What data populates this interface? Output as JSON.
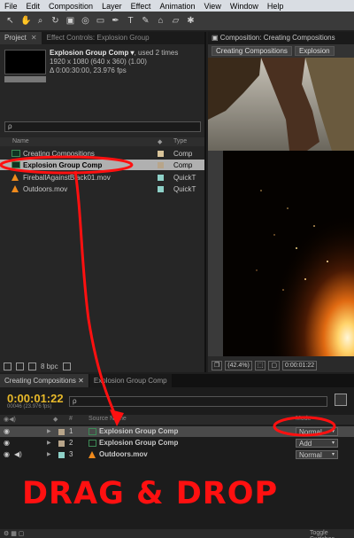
{
  "menu": [
    "File",
    "Edit",
    "Composition",
    "Layer",
    "Effect",
    "Animation",
    "View",
    "Window",
    "Help"
  ],
  "toolbar_icons": [
    "selection-icon",
    "hand-icon",
    "zoom-icon",
    "rotate-icon",
    "camera-icon",
    "pan-behind-icon",
    "mask-icon",
    "pen-icon",
    "type-icon",
    "brush-icon",
    "clone-stamp-icon",
    "eraser-icon",
    "puppet-icon"
  ],
  "project": {
    "tab": "Project",
    "effect_tab": "Effect Controls: Explosion Group",
    "info": {
      "name": "Explosion Group Comp ▾",
      "used": ", used 2 times",
      "size": "1920 x 1080  (640 x 360) (1.00)",
      "duration": "Δ 0:00:30:00, 23.976 fps"
    },
    "search_placeholder": "ρ",
    "col_name": "Name",
    "col_type": "Type",
    "items": [
      {
        "name": "Creating Compositions",
        "type": "Comp",
        "label_color": "#d9c49a",
        "icon": "composition-icon"
      },
      {
        "name": "Explosion Group Comp",
        "type": "Comp",
        "label_color": "#b8a58a",
        "icon": "composition-icon"
      },
      {
        "name": "FireballAgainstBlack01.mov",
        "type": "QuickT",
        "label_color": "#8ed1c8",
        "icon": "footage-icon"
      },
      {
        "name": "Outdoors.mov",
        "type": "QuickT",
        "label_color": "#8ed1c8",
        "icon": "vlc-cone-icon"
      }
    ],
    "bpc": "8 bpc"
  },
  "comp": {
    "tab": "Composition: Creating Compositions",
    "breadcrumbs": [
      "Creating Compositions",
      "Explosion"
    ],
    "zoom": "(42.4%)",
    "timecode": "0:00:01:22"
  },
  "timeline": {
    "tabs": [
      "Creating Compositions",
      "Explosion Group Comp"
    ],
    "timecode": "0:00:01:22",
    "frames": "00046 (23.976 fps)",
    "search_placeholder": "ρ",
    "col_source": "Source Name",
    "col_mode": "Mode",
    "col_num": "#",
    "layers": [
      {
        "num": "1",
        "name": "Explosion Group Comp",
        "mode": "Normal",
        "label_color": "#b8a58a"
      },
      {
        "num": "2",
        "name": "Explosion Group Comp",
        "mode": "Add",
        "label_color": "#b8a58a"
      },
      {
        "num": "3",
        "name": "Outdoors.mov",
        "mode": "Normal",
        "label_color": "#8ed1c8"
      }
    ],
    "toggle": "Toggle Switches"
  },
  "annotation": "DRAG & DROP"
}
